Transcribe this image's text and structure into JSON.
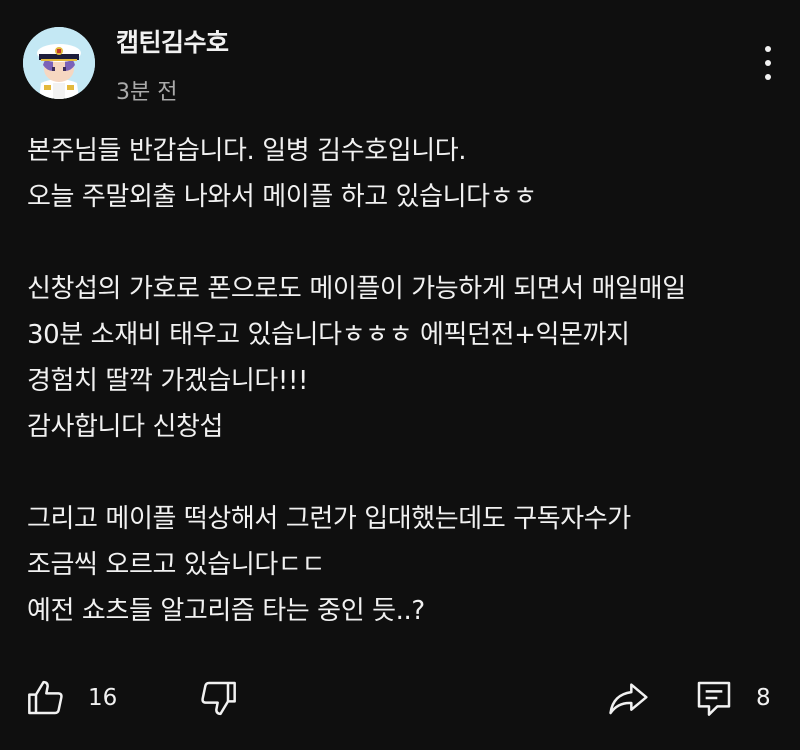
{
  "post": {
    "author": "캡틴김수호",
    "time": "3분 전",
    "lines": [
      "본주님들 반갑습니다. 일병 김수호입니다.",
      "오늘 주말외출 나와서 메이플 하고 있습니다ㅎㅎ",
      "",
      "신창섭의 가호로 폰으로도 메이플이 가능하게 되면서 매일매일",
      "30분 소재비 태우고 있습니다ㅎㅎㅎ 에픽던전+익몬까지",
      "경험치 딸깍 가겠습니다!!!",
      "감사합니다 신창섭",
      "",
      "그리고 메이플 떡상해서 그런가 입대했는데도 구독자수가",
      "조금씩 오르고 있습니다ㄷㄷ",
      "예전 쇼츠들 알고리즘 타는 중인 듯..?"
    ]
  },
  "actions": {
    "like_count": "16",
    "comment_count": "8"
  },
  "icons": {
    "more": "more-vertical-icon",
    "like": "thumbs-up-icon",
    "dislike": "thumbs-down-icon",
    "share": "share-icon",
    "comment": "comment-icon"
  },
  "colors": {
    "background": "#0f0f0f",
    "text": "#f1f1f1",
    "secondary": "#aaaaaa"
  }
}
